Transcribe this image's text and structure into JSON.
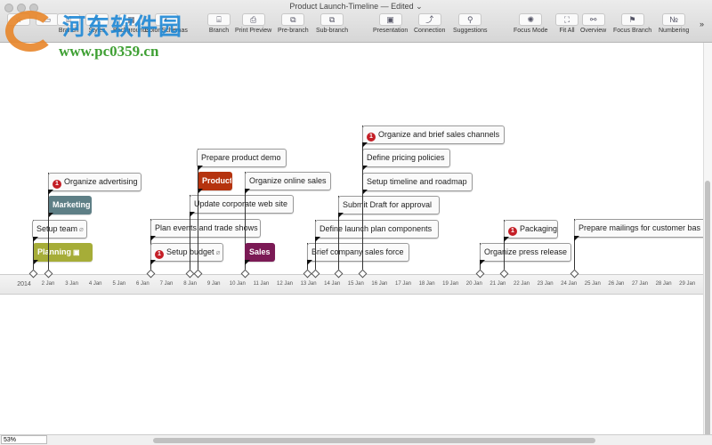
{
  "window": {
    "title": "Product Launch-Timeline — Edited ⌄"
  },
  "toolbar": {
    "items": [
      {
        "label": "Branch",
        "icon": "branch-icon"
      },
      {
        "label": "Styles",
        "icon": "styles-icon"
      },
      {
        "label": "Backgrounds",
        "icon": "backgrounds-icon"
      },
      {
        "label": "Color Schemas",
        "icon": "color-schemas-icon"
      },
      {
        "label": "Branch",
        "icon": "branch-icon"
      },
      {
        "label": "Print Preview",
        "icon": "printer-icon"
      },
      {
        "label": "Pre-branch",
        "icon": "pre-branch-icon"
      },
      {
        "label": "Sub-branch",
        "icon": "sub-branch-icon"
      },
      {
        "label": "Presentation",
        "icon": "presentation-icon"
      },
      {
        "label": "Connection",
        "icon": "connection-icon"
      },
      {
        "label": "Suggestions",
        "icon": "suggestions-icon"
      },
      {
        "label": "Focus Mode",
        "icon": "focus-mode-icon"
      },
      {
        "label": "Fit All",
        "icon": "fit-all-icon"
      },
      {
        "label": "Overview",
        "icon": "binoculars-icon"
      },
      {
        "label": "Focus Branch",
        "icon": "focus-branch-icon"
      },
      {
        "label": "Numbering",
        "icon": "numbering-icon"
      }
    ],
    "overflow": "»"
  },
  "watermark": {
    "name": "河东软件园",
    "url": "www.pc0359.cn"
  },
  "topics": [
    {
      "label": "Planning",
      "color": "#a6ad38"
    },
    {
      "label": "Setup team"
    },
    {
      "label": "Marketing",
      "color": "#5e7f86"
    },
    {
      "label": "Organize advertising",
      "priority": "1"
    },
    {
      "label": "Plan events and trade shows"
    },
    {
      "label": "Setup budget",
      "priority": "1"
    },
    {
      "label": "Update corporate web site"
    },
    {
      "label": "Product",
      "color": "#b5330e"
    },
    {
      "label": "Prepare product demo"
    },
    {
      "label": "Organize online sales"
    },
    {
      "label": "Sales",
      "color": "#7b1a55"
    },
    {
      "label": "Brief company sales force"
    },
    {
      "label": "Define launch plan components"
    },
    {
      "label": "Submit Draft for approval"
    },
    {
      "label": "Setup timeline and roadmap"
    },
    {
      "label": "Define pricing policies"
    },
    {
      "label": "Organize and brief sales channels",
      "priority": "1"
    },
    {
      "label": "Organize press release"
    },
    {
      "label": "Packaging",
      "priority": "1"
    },
    {
      "label": "Prepare mailings for customer bas"
    }
  ],
  "timeline": {
    "year": "2014",
    "days": [
      "2 Jan",
      "3 Jan",
      "4 Jan",
      "5 Jan",
      "6 Jan",
      "7 Jan",
      "8 Jan",
      "9 Jan",
      "10 Jan",
      "11 Jan",
      "12 Jan",
      "13 Jan",
      "14 Jan",
      "15 Jan",
      "16 Jan",
      "17 Jan",
      "18 Jan",
      "19 Jan",
      "20 Jan",
      "21 Jan",
      "22 Jan",
      "23 Jan",
      "24 Jan",
      "25 Jan",
      "26 Jan",
      "27 Jan",
      "28 Jan",
      "29 Jan"
    ]
  },
  "status": {
    "zoom": "53%"
  }
}
